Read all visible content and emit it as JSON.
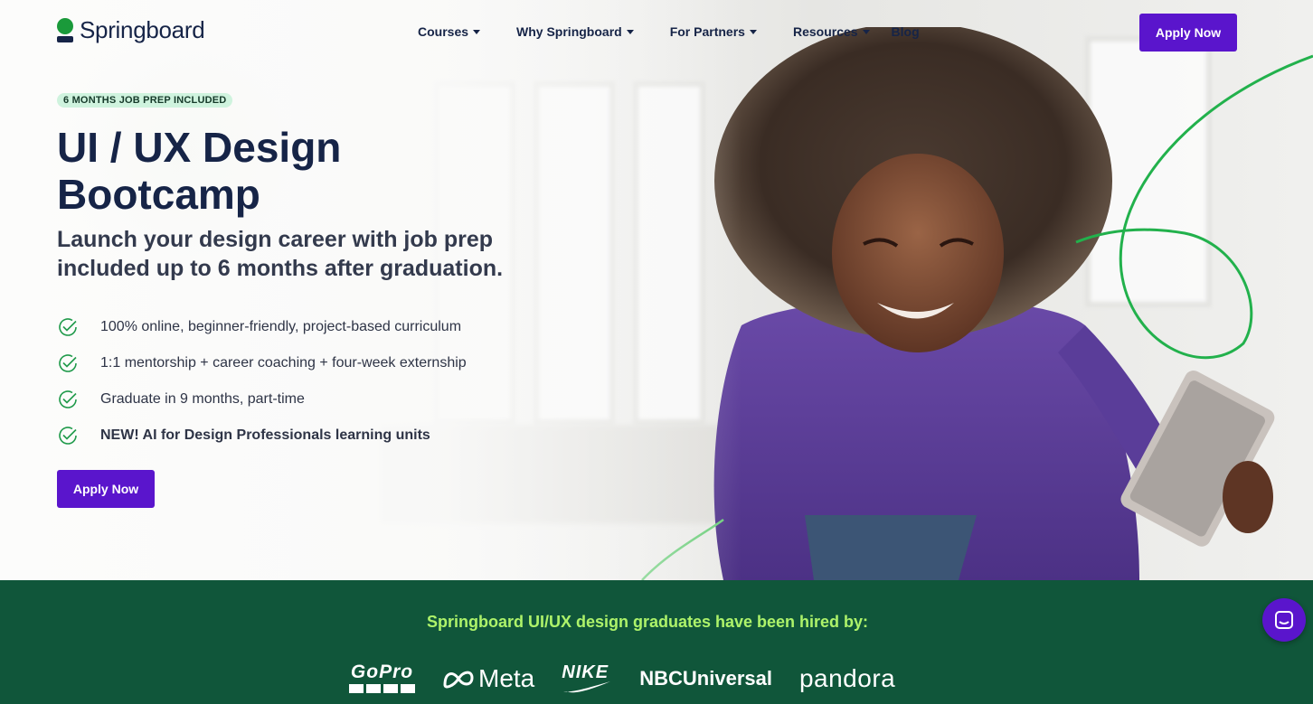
{
  "header": {
    "logo_text": "Springboard",
    "nav": [
      {
        "label": "Courses",
        "has_dropdown": true
      },
      {
        "label": "Why Springboard",
        "has_dropdown": true
      },
      {
        "label": "For Partners",
        "has_dropdown": true
      },
      {
        "label": "Resources",
        "has_dropdown": true
      },
      {
        "label": "Blog",
        "has_dropdown": false
      }
    ],
    "cta_label": "Apply Now"
  },
  "hero": {
    "badge": "6 MONTHS JOB PREP INCLUDED",
    "title": "UI / UX Design Bootcamp",
    "subtitle": "Launch your design career with job prep included up to 6 months after graduation.",
    "features": [
      "100% online, beginner-friendly, project-based curriculum",
      "1:1 mentorship + career coaching + four-week externship",
      "Graduate in 9 months, part-time",
      "NEW! AI for Design Professionals learning units"
    ],
    "cta_label": "Apply Now"
  },
  "hired_by": {
    "title": "Springboard UI/UX design graduates have been hired by:",
    "companies": [
      "GoPro",
      "Meta",
      "NIKE",
      "NBCUniversal",
      "pandora"
    ]
  },
  "icons": {
    "check": "check-circle-icon",
    "chat": "chat-icon",
    "caret": "caret-down-icon"
  },
  "colors": {
    "primary_purple": "#5a15cc",
    "brand_green": "#1a9a3a",
    "band_green": "#10563a",
    "band_title": "#aef36a",
    "navy_text": "#162447"
  }
}
